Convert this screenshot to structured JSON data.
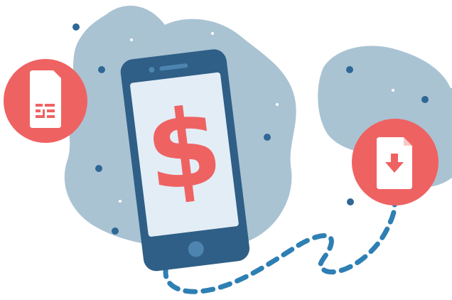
{
  "colors": {
    "blob": "#a9c3d3",
    "dot": "#2f6795",
    "sparkle": "#ffffff",
    "accent": "#ef6262",
    "phone_body": "#2f5f86",
    "phone_screen": "#e3edf6",
    "phone_detail": "#4d85b0",
    "path": "#2e7fb3"
  },
  "icons": {
    "sim": "sim-card-icon",
    "download": "download-file-icon",
    "phone": "smartphone-icon"
  },
  "screen": {
    "symbol": "$"
  }
}
